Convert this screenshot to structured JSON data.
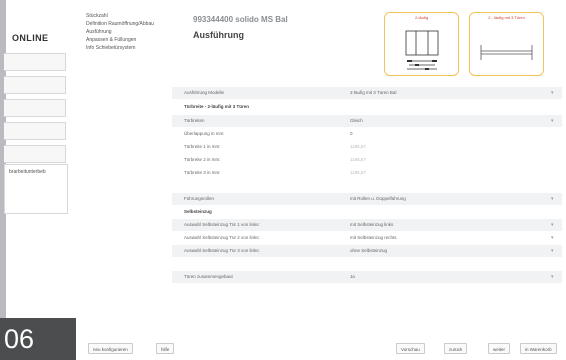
{
  "sidebar": {
    "brand": "ONLINE",
    "buttons": [
      "",
      "",
      "",
      "",
      ""
    ],
    "panel": {
      "number": "",
      "text": "brarbeitunterbeb"
    },
    "badge": "06"
  },
  "nav": {
    "items": [
      "Stückzahl",
      "Definition Raumöffnung/Abbau",
      "Ausführung",
      "Anpassen & Füllungen",
      "Info Schiebetürsystem"
    ]
  },
  "header": {
    "product_code": "993344400 solido MS Bal",
    "title": "Ausführung"
  },
  "illustrations": [
    {
      "caption": "2-läufig"
    },
    {
      "caption": "2 - läufig mit 3 Türen"
    }
  ],
  "form": {
    "rows": [
      {
        "label": "Ausführung Modelle",
        "value": "2-läufig mit 3 Türen Bal",
        "arrow": "▾",
        "bold": false,
        "dim": false
      },
      {
        "label": "Türbreite - 2-läufig mit 3 Türen",
        "value": "",
        "arrow": "",
        "bold": true,
        "dim": false
      },
      {
        "label": "Türbreiten",
        "value": "Gleich",
        "arrow": "▾",
        "bold": false,
        "dim": false
      },
      {
        "label": "Überlappung in mm:",
        "value": "0",
        "arrow": "",
        "bold": false,
        "dim": false
      },
      {
        "label": "Türbreite 1 in mm:",
        "value": "1185,67",
        "arrow": "",
        "bold": false,
        "dim": true
      },
      {
        "label": "Türbreite 2 in mm:",
        "value": "1185,67",
        "arrow": "",
        "bold": false,
        "dim": true
      },
      {
        "label": "Türbreite 3 in mm:",
        "value": "1185,67",
        "arrow": "",
        "bold": false,
        "dim": true
      },
      {
        "label": "Führungsrollen",
        "value": "mit Rollen u. Doppelführung",
        "arrow": "▾",
        "bold": false,
        "dim": false
      },
      {
        "label": "Selbsteinzug",
        "value": "",
        "arrow": "",
        "bold": true,
        "dim": false
      },
      {
        "label": "Auswahl Selbsteinzug Tür 1 von links:",
        "value": "mit Selbsteinzug links",
        "arrow": "▾",
        "bold": false,
        "dim": false
      },
      {
        "label": "Auswahl Selbsteinzug Tür 2 von links:",
        "value": "mit Selbsteinzug rechts",
        "arrow": "▾",
        "bold": false,
        "dim": false
      },
      {
        "label": "Auswahl Selbsteinzug Tür 3 von links:",
        "value": "ohne Selbsteinzug",
        "arrow": "▾",
        "bold": false,
        "dim": false
      },
      {
        "label": "Türen zusammengebaut",
        "value": "Ja",
        "arrow": "▾",
        "bold": false,
        "dim": false
      }
    ]
  },
  "footer": {
    "reconfigure": "neu konfigurieren",
    "help": "hilfe",
    "preview": "Vorschau",
    "back": "zurück",
    "next": "weiter",
    "cart": "in Warenkorb"
  }
}
